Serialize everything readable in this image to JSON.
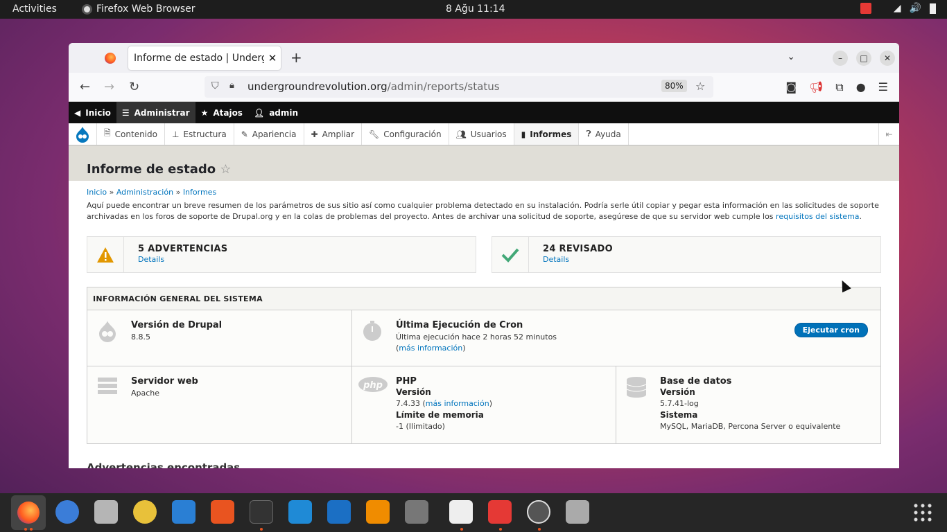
{
  "topbar": {
    "activities": "Activities",
    "app": "Firefox Web Browser",
    "clock": "8 Ağu  11:14"
  },
  "browser": {
    "tab_title": "Informe de estado | Undergr",
    "url_host": "undergroundrevolution.org",
    "url_path": "/admin/reports/status",
    "zoom": "80%"
  },
  "drupal_top": {
    "items": [
      "Inicio",
      "Administrar",
      "Atajos",
      "admin"
    ]
  },
  "drupal_tray": {
    "items": [
      "Contenido",
      "Estructura",
      "Apariencia",
      "Ampliar",
      "Configuración",
      "Usuarios",
      "Informes",
      "Ayuda"
    ]
  },
  "page": {
    "title": "Informe de estado",
    "breadcrumb": [
      "Inicio",
      "Administración",
      "Informes"
    ],
    "intro": "Aquí puede encontrar un breve resumen de los parámetros de sus sitio así como cualquier problema detectado en su instalación. Podría serle útil copiar y pegar esta información en las solicitudes de soporte archivadas en los foros de soporte de Drupal.org y en la colas de problemas del proyecto. Antes de archivar una solicitud de soporte, asegúrese de que su servidor web cumple los ",
    "intro_link": "requisitos del sistema",
    "warnings": {
      "title": "5 ADVERTENCIAS",
      "link": "Details"
    },
    "checked": {
      "title": "24 REVISADO",
      "link": "Details"
    },
    "sysinfo_title": "INFORMACIÓN GENERAL DEL SISTEMA",
    "drupal": {
      "title": "Versión de Drupal",
      "value": "8.8.5"
    },
    "cron": {
      "title": "Última Ejecución de Cron",
      "value": "Última ejecución hace 2 horas 52 minutos",
      "more_open": "(",
      "more": "más información",
      "more_close": ")",
      "button": "Ejecutar cron"
    },
    "web": {
      "title": "Servidor web",
      "value": "Apache"
    },
    "php": {
      "title": "PHP",
      "version_label": "Versión",
      "version": "7.4.33 (",
      "more": "más información",
      "more_close": ")",
      "mem_label": "Límite de memoria",
      "mem": "-1 (Ilimitado)",
      "logo": "php"
    },
    "db": {
      "title": "Base de datos",
      "version_label": "Versión",
      "version": "5.7.41-log",
      "system_label": "Sistema",
      "system": "MySQL, MariaDB, Percona Server o equivalente"
    },
    "warnings_found": "Advertencias encontradas"
  }
}
